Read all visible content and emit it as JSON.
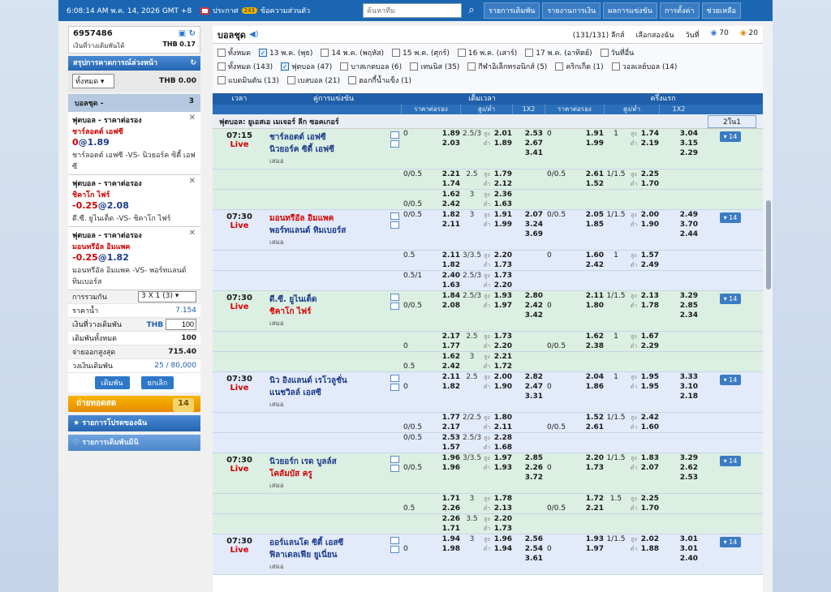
{
  "topbar": {
    "datetime": "6:08:14 AM พ.ค. 14, 2026 GMT +8",
    "notice_label": "ประกาศ",
    "notice_badge": "243",
    "messages": "ข้อความส่วนตัว",
    "search_placeholder": "ค้นหาทีม",
    "nav": [
      "รายการเดิมพัน",
      "รายงานการเงิน",
      "ผลการแข่งขัน",
      "การตั้งค่า",
      "ช่วยเหลือ"
    ]
  },
  "account": {
    "id": "6957486",
    "balance_label": "เงินที่วางเดิมพันได้",
    "currency": "THB",
    "balance": "0.17"
  },
  "summary_panel": {
    "title": "สรุปการคาดการณ์ล่วงหน้า",
    "filter_value": "ทั้งหมด",
    "filter_amount": "THB 0.00"
  },
  "slip": {
    "title": "บอลชุด -",
    "count": "3",
    "bets": [
      {
        "type": "ฟุตบอล - ราคาต่อรอง",
        "team": "ชาร์ลอตต์ เอฟซี",
        "line": "0",
        "odds": "1.89",
        "vs": "ชาร์ลอตต์ เอฟซี -VS- นิวยอร์ค ซิตี้ เอฟซี"
      },
      {
        "type": "ฟุตบอล - ราคาต่อรอง",
        "team": "ชิคาโก ไฟร์",
        "line": "-0.25",
        "odds": "2.08",
        "vs": "ดี.ซี. ยูไนเต็ด -VS- ชิคาโก ไฟร์"
      },
      {
        "type": "ฟุตบอล - ราคาต่อรอง",
        "team": "มอนทรีอัล อิมแพค",
        "line": "-0.25",
        "odds": "1.82",
        "vs": "มอนทรีอัล อิมแพค -VS- พอร์ทแลนด์ ทิมเบอร์ส"
      }
    ]
  },
  "bet_summary": {
    "combo_label": "การรวมกัน",
    "combo_value": "3 X 1 (3)",
    "water_label": "ราคาน้ำ",
    "water_value": "7.154",
    "stake_label": "เงินที่วางเดิมพัน",
    "stake_currency": "THB",
    "stake_value": "100",
    "total_label": "เดิมพันทั้งหมด",
    "total_value": "100",
    "maxpay_label": "จ่ายออกสูงสุด",
    "maxpay_value": "715.40",
    "limit_label": "วงเงินเดิมพัน",
    "limit_value": "25 / 80,000",
    "bet_btn": "เดิมพัน",
    "cancel_btn": "ยกเลิก"
  },
  "live_button": {
    "label": "ถ่ายทอดสด",
    "count": "14"
  },
  "side_items": [
    "รายการโปรดของฉัน",
    "รายการเดิมพันมินิ"
  ],
  "main": {
    "title": "บอลชุด",
    "count_text": "(131/131) ลีกส์",
    "select_label": "เลือกสองฉัน",
    "day_label": "วันที่",
    "c70": "70",
    "c20": "20",
    "dates_line1": [
      {
        "label": "ทั้งหมด",
        "on": false
      },
      {
        "label": "13 พ.ค. (พุธ)",
        "on": true
      },
      {
        "label": "14 พ.ค. (พฤหัส)",
        "on": false
      },
      {
        "label": "15 พ.ค. (ศุกร์)",
        "on": false
      },
      {
        "label": "16 พ.ค. (เสาร์)",
        "on": false
      },
      {
        "label": "17 พ.ค. (อาทิตย์)",
        "on": false
      },
      {
        "label": "วันที่อื่น",
        "on": false
      }
    ],
    "dates_line2": [
      {
        "label": "ทั้งหมด (143)",
        "on": false
      },
      {
        "label": "ฟุตบอล (47)",
        "on": true
      },
      {
        "label": "บาสเกตบอล (6)",
        "on": false
      },
      {
        "label": "เทนนิส (35)",
        "on": false
      },
      {
        "label": "กีฬาอิเล็กทรอนิกส์ (5)",
        "on": false
      },
      {
        "label": "คริกเก็ต (1)",
        "on": false
      },
      {
        "label": "วอลเลย์บอล (14)",
        "on": false
      }
    ],
    "dates_line3": [
      {
        "label": "แบดมินตัน (13)",
        "on": false
      },
      {
        "label": "เบสบอล (21)",
        "on": false
      },
      {
        "label": "ฮอกกี้น้ำแข็ง (1)",
        "on": false
      }
    ]
  },
  "table": {
    "h_time": "เวลา",
    "h_match": "คู่การแข่งขัน",
    "h_full": "เต็มเวลา",
    "h_half": "ครึ่งแรก",
    "sub": [
      "ราคาต่อรอง",
      "สูง/ต่ำ",
      "1X2",
      "ราคาต่อรอง",
      "สูง/ต่ำ",
      "1X2"
    ],
    "league": "ฟุตบอล: ยูเอสเอ เมเจอร์ ลีก ซอคเกอร์",
    "league_btn": "2ใน1",
    "matches": [
      {
        "time": "07:15",
        "live": "Live",
        "home": "ชาร์ลอตต์ เอฟซี",
        "away": "นิวยอร์ค ซิตี้ เอฟซี",
        "home_red": false,
        "away_red": false,
        "draw": "เสมอ",
        "more": "▾ 14",
        "bg": "g",
        "rows": [
          [
            "0",
            "1.89",
            "2.5/3",
            "สูง",
            "2.01",
            "2.53",
            "0",
            "1.91",
            "1",
            "สูง",
            "1.74",
            "3.04"
          ],
          [
            "",
            "2.03",
            "",
            "ต่ำ",
            "1.89",
            "2.67",
            "",
            "1.99",
            "",
            "ต่ำ",
            "2.19",
            "3.15"
          ],
          [
            "",
            "",
            "",
            "",
            "",
            "3.41",
            "",
            "",
            "",
            "",
            "",
            "2.29"
          ]
        ],
        "subs": [
          [
            [
              "0/0.5",
              "2.21",
              "2.5",
              "สูง",
              "1.79",
              "",
              "0/0.5",
              "2.61",
              "1/1.5",
              "สูง",
              "2.25",
              ""
            ],
            [
              "",
              "1.74",
              "",
              "ต่ำ",
              "2.12",
              "",
              "",
              "1.52",
              "",
              "ต่ำ",
              "1.70",
              ""
            ]
          ],
          [
            [
              "",
              "1.62",
              "3",
              "สูง",
              "2.36",
              "",
              "",
              "",
              "",
              "",
              "",
              ""
            ],
            [
              "0/0.5",
              "2.42",
              "",
              "ต่ำ",
              "1.63",
              "",
              "",
              "",
              "",
              "",
              "",
              ""
            ]
          ]
        ]
      },
      {
        "time": "07:30",
        "live": "Live",
        "home": "มอนทรีอัล อิมแพค",
        "away": "พอร์ทแลนด์ ทิมเบอร์ส",
        "home_red": true,
        "away_red": false,
        "draw": "เสมอ",
        "more": "▾ 14",
        "bg": "b",
        "rows": [
          [
            "0/0.5",
            "1.82",
            "3",
            "สูง",
            "1.91",
            "2.07",
            "0/0.5",
            "2.05",
            "1/1.5",
            "สูง",
            "2.00",
            "2.49"
          ],
          [
            "",
            "2.11",
            "",
            "ต่ำ",
            "1.99",
            "3.24",
            "",
            "1.85",
            "",
            "ต่ำ",
            "1.90",
            "3.70"
          ],
          [
            "",
            "",
            "",
            "",
            "",
            "3.69",
            "",
            "",
            "",
            "",
            "",
            "2.44"
          ]
        ],
        "subs": [
          [
            [
              "0.5",
              "2.11",
              "3/3.5",
              "สูง",
              "2.20",
              "",
              "0",
              "1.60",
              "1",
              "สูง",
              "1.57",
              ""
            ],
            [
              "",
              "1.82",
              "",
              "ต่ำ",
              "1.73",
              "",
              "",
              "2.42",
              "",
              "ต่ำ",
              "2.49",
              ""
            ]
          ],
          [
            [
              "0.5/1",
              "2.40",
              "2.5/3",
              "สูง",
              "1.73",
              "",
              "",
              "",
              "",
              "",
              "",
              ""
            ],
            [
              "",
              "1.63",
              "",
              "ต่ำ",
              "2.20",
              "",
              "",
              "",
              "",
              "",
              "",
              ""
            ]
          ]
        ]
      },
      {
        "time": "07:30",
        "live": "Live",
        "home": "ดี.ซี. ยูไนเต็ด",
        "away": "ชิคาโก ไฟร์",
        "home_red": false,
        "away_red": true,
        "draw": "เสมอ",
        "more": "▾ 14",
        "bg": "g",
        "rows": [
          [
            "",
            "1.84",
            "2.5/3",
            "สูง",
            "1.93",
            "2.80",
            "",
            "2.11",
            "1/1.5",
            "สูง",
            "2.13",
            "3.29"
          ],
          [
            "0/0.5",
            "2.08",
            "",
            "ต่ำ",
            "1.97",
            "2.42",
            "0",
            "1.80",
            "",
            "ต่ำ",
            "1.78",
            "2.85"
          ],
          [
            "",
            "",
            "",
            "",
            "",
            "3.42",
            "",
            "",
            "",
            "",
            "",
            "2.34"
          ]
        ],
        "subs": [
          [
            [
              "",
              "2.17",
              "2.5",
              "สูง",
              "1.73",
              "",
              "",
              "1.62",
              "1",
              "สูง",
              "1.67",
              ""
            ],
            [
              "0",
              "1.77",
              "",
              "ต่ำ",
              "2.20",
              "",
              "0/0.5",
              "2.38",
              "",
              "ต่ำ",
              "2.29",
              ""
            ]
          ],
          [
            [
              "",
              "1.62",
              "3",
              "สูง",
              "2.21",
              "",
              "",
              "",
              "",
              "",
              "",
              ""
            ],
            [
              "0.5",
              "2.42",
              "",
              "ต่ำ",
              "1.72",
              "",
              "",
              "",
              "",
              "",
              "",
              ""
            ]
          ]
        ]
      },
      {
        "time": "07:30",
        "live": "Live",
        "home": "นิว อิงแลนด์ เรโวลูชั่น",
        "away": "แนชวิลล์ เอสซี",
        "home_red": false,
        "away_red": false,
        "draw": "เสมอ",
        "more": "▾ 14",
        "bg": "b",
        "rows": [
          [
            "",
            "2.11",
            "2.5",
            "สูง",
            "2.00",
            "2.82",
            "",
            "2.04",
            "1",
            "สูง",
            "1.95",
            "3.33"
          ],
          [
            "0",
            "1.82",
            "",
            "ต่ำ",
            "1.90",
            "2.47",
            "0",
            "1.86",
            "",
            "ต่ำ",
            "1.95",
            "3.10"
          ],
          [
            "",
            "",
            "",
            "",
            "",
            "3.31",
            "",
            "",
            "",
            "",
            "",
            "2.18"
          ]
        ],
        "subs": [
          [
            [
              "",
              "1.77",
              "2/2.5",
              "สูง",
              "1.80",
              "",
              "",
              "1.52",
              "1/1.5",
              "สูง",
              "2.42",
              ""
            ],
            [
              "0/0.5",
              "2.17",
              "",
              "ต่ำ",
              "2.11",
              "",
              "0/0.5",
              "2.61",
              "",
              "ต่ำ",
              "1.60",
              ""
            ]
          ],
          [
            [
              "0/0.5",
              "2.53",
              "2.5/3",
              "สูง",
              "2.28",
              "",
              "",
              "",
              "",
              "",
              "",
              ""
            ],
            [
              "",
              "1.57",
              "",
              "ต่ำ",
              "1.68",
              "",
              "",
              "",
              "",
              "",
              "",
              ""
            ]
          ]
        ]
      },
      {
        "time": "07:30",
        "live": "Live",
        "home": "นิวยอร์ก เรด บูลล์ส",
        "away": "โคลัมบัส ครู",
        "home_red": false,
        "away_red": true,
        "draw": "เสมอ",
        "more": "▾ 14",
        "bg": "g",
        "rows": [
          [
            "",
            "1.96",
            "3/3.5",
            "สูง",
            "1.97",
            "2.85",
            "",
            "2.20",
            "1/1.5",
            "สูง",
            "1.83",
            "3.29"
          ],
          [
            "0/0.5",
            "1.96",
            "",
            "ต่ำ",
            "1.93",
            "2.26",
            "0",
            "1.73",
            "",
            "ต่ำ",
            "2.07",
            "2.62"
          ],
          [
            "",
            "",
            "",
            "",
            "",
            "3.72",
            "",
            "",
            "",
            "",
            "",
            "2.53"
          ]
        ],
        "subs": [
          [
            [
              "",
              "1.71",
              "3",
              "สูง",
              "1.78",
              "",
              "",
              "1.72",
              "1.5",
              "สูง",
              "2.25",
              ""
            ],
            [
              "0.5",
              "2.26",
              "",
              "ต่ำ",
              "2.13",
              "",
              "0/0.5",
              "2.21",
              "",
              "ต่ำ",
              "1.70",
              ""
            ]
          ],
          [
            [
              "",
              "2.26",
              "3.5",
              "สูง",
              "2.20",
              "",
              "",
              "",
              "",
              "",
              "",
              ""
            ],
            [
              "",
              "1.71",
              "",
              "ต่ำ",
              "1.73",
              "",
              "",
              "",
              "",
              "",
              "",
              ""
            ]
          ]
        ]
      },
      {
        "time": "07:30",
        "live": "Live",
        "home": "ออร์แลนโด ซิตี้ เอสซี",
        "away": "ฟิลาเดลเฟีย ยูเนี่ยน",
        "home_red": false,
        "away_red": false,
        "draw": "เสมอ",
        "more": "▾ 14",
        "bg": "b",
        "rows": [
          [
            "",
            "1.94",
            "3",
            "สูง",
            "1.96",
            "2.56",
            "",
            "1.93",
            "1/1.5",
            "สูง",
            "2.02",
            "3.01"
          ],
          [
            "0",
            "1.98",
            "",
            "ต่ำ",
            "1.94",
            "2.54",
            "0",
            "1.97",
            "",
            "ต่ำ",
            "1.88",
            "3.01"
          ],
          [
            "",
            "",
            "",
            "",
            "",
            "3.61",
            "",
            "",
            "",
            "",
            "",
            "2.40"
          ]
        ],
        "subs": []
      }
    ]
  }
}
